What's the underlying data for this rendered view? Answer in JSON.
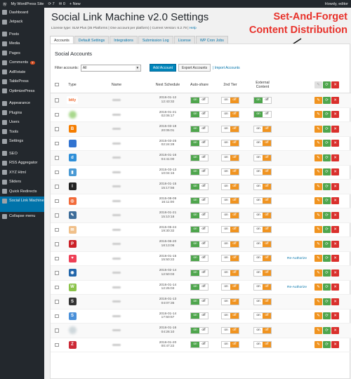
{
  "topbar": {
    "site": "My WordPress Site",
    "updates": "7",
    "comments": "0",
    "new": "+ New",
    "howdy": "Howdy, editor"
  },
  "sidebar": {
    "items": [
      {
        "label": "Dashboard"
      },
      {
        "label": "Jetpack"
      },
      {
        "label": "Posts"
      },
      {
        "label": "Media"
      },
      {
        "label": "Pages"
      },
      {
        "label": "Comments",
        "badge": "7"
      },
      {
        "label": "AdRotate"
      },
      {
        "label": "TablePress"
      },
      {
        "label": "OptimizePress"
      },
      {
        "label": "Appearance"
      },
      {
        "label": "Plugins"
      },
      {
        "label": "Users"
      },
      {
        "label": "Tools"
      },
      {
        "label": "Settings"
      },
      {
        "label": "SEO"
      },
      {
        "label": "RSS Aggregator"
      },
      {
        "label": "XYZ Html"
      },
      {
        "label": "Sliders"
      },
      {
        "label": "Quick Redirects"
      },
      {
        "label": "Social Link Machine"
      },
      {
        "label": "Collapse menu"
      }
    ]
  },
  "page": {
    "title": "Social Link Machine v2.0 Settings",
    "license": "License type: SLM Plus (35 Platforms | One account per platform) | Current Version: 6.2.79 |",
    "help": "Help",
    "annotation_line1": "Set-And-Forget",
    "annotation_line2": "Content Distribution"
  },
  "tabs": [
    {
      "label": "Accounts"
    },
    {
      "label": "Default Settings"
    },
    {
      "label": "Integrations"
    },
    {
      "label": "Submission Log"
    },
    {
      "label": "License"
    },
    {
      "label": "WP Cron Jobs"
    }
  ],
  "panel": {
    "title": "Social Accounts",
    "filter_label": "Filter accounts:",
    "filter_value": "All",
    "add_account": "Add Account",
    "export_accounts": "Export Accounts",
    "import_accounts": "| Import Accounts"
  },
  "table": {
    "headers": {
      "type": "Type",
      "name": "Name",
      "next": "Next Schedule",
      "auto": "Auto-share",
      "tier": "2nd Tier",
      "ext1": "External",
      "ext2": "Content"
    },
    "on": "on",
    "off": "off",
    "reauth": "Re-Authorize",
    "rows": [
      {
        "icon": "bitly",
        "icon_color": "#ee6123",
        "icon_text": "bitly",
        "d": "2016-01-12",
        "t": "12:43:32",
        "auto": "on",
        "tier": "off",
        "ext": "on",
        "reauth": false
      },
      {
        "icon": "blurred-icon",
        "icon_color": "#a8d88c",
        "icon_text": "",
        "d": "2016-01-21",
        "t": "02:06:17",
        "auto": "on",
        "tier": "off",
        "ext": "on",
        "reauth": false
      },
      {
        "icon": "blogger-icon",
        "icon_color": "#f57d00",
        "icon_text": "B",
        "d": "2015-03-18",
        "t": "20:05:01",
        "auto": "on",
        "tier": "off",
        "ext": "off",
        "reauth": false
      },
      {
        "icon": "delicious-icon",
        "icon_color": "#3274d1",
        "icon_text": "",
        "d": "2015-03-25",
        "t": "02:24:28",
        "auto": "on",
        "tier": "off",
        "ext": "off",
        "reauth": false
      },
      {
        "icon": "diigo-icon",
        "icon_color": "#2f8fd8",
        "icon_text": "d",
        "d": "2016-01-16",
        "t": "04:41:00",
        "auto": "on",
        "tier": "off",
        "ext": "off",
        "reauth": false
      },
      {
        "icon": "chart-icon",
        "icon_color": "#4a9ad4",
        "icon_text": "▮",
        "d": "2015-03-13",
        "t": "10:04:16",
        "auto": "on",
        "tier": "off",
        "ext": "off",
        "reauth": false
      },
      {
        "icon": "instapaper-icon",
        "icon_color": "#222222",
        "icon_text": "I",
        "d": "2016-01-15",
        "t": "15:17:56",
        "auto": "on",
        "tier": "off",
        "ext": "off",
        "reauth": false
      },
      {
        "icon": "target-icon",
        "icon_color": "#f26b3a",
        "icon_text": "◎",
        "d": "2015-08-09",
        "t": "16:11:00",
        "auto": "on",
        "tier": "off",
        "ext": "off",
        "reauth": false
      },
      {
        "icon": "linkedin-icon",
        "icon_color": "#3e6d9a",
        "icon_text": "✎",
        "d": "2016-01-21",
        "t": "15:10:18",
        "auto": "on",
        "tier": "off",
        "ext": "off",
        "reauth": false
      },
      {
        "icon": "mail-icon",
        "icon_color": "#f0c08a",
        "icon_text": "✉",
        "d": "2015-05-24",
        "t": "19:30:32",
        "auto": "on",
        "tier": "off",
        "ext": "off",
        "reauth": false
      },
      {
        "icon": "pinterest-icon",
        "icon_color": "#cb2027",
        "icon_text": "P",
        "d": "2015-06-20",
        "t": "18:13:06",
        "auto": "on",
        "tier": "off",
        "ext": "off",
        "reauth": false
      },
      {
        "icon": "pocket-icon",
        "icon_color": "#ee4056",
        "icon_text": "♥",
        "d": "2016-01-15",
        "t": "15:50:22",
        "auto": "on",
        "tier": "off",
        "ext": "off",
        "reauth": true
      },
      {
        "icon": "stumble-icon",
        "icon_color": "#2266aa",
        "icon_text": "◉",
        "d": "2015-02-14",
        "t": "12:50:03",
        "auto": "on",
        "tier": "off",
        "ext": "off",
        "reauth": false
      },
      {
        "icon": "friendfeed-icon",
        "icon_color": "#8bc34a",
        "icon_text": "W",
        "d": "2016-01-14",
        "t": "12:25:03",
        "auto": "on",
        "tier": "off",
        "ext": "off",
        "reauth": true
      },
      {
        "icon": "scoopit-icon",
        "icon_color": "#333333",
        "icon_text": "S",
        "d": "2016-01-13",
        "t": "04:07:35",
        "auto": "on",
        "tier": "off",
        "ext": "off",
        "reauth": false
      },
      {
        "icon": "slm-icon",
        "icon_color": "#4a90d9",
        "icon_text": "S",
        "d": "2016-01-14",
        "t": "17:50:57",
        "auto": "on",
        "tier": "off",
        "ext": "off",
        "reauth": false
      },
      {
        "icon": "blurred-icon",
        "icon_color": "#cfd8dc",
        "icon_text": "",
        "d": "2016-01-16",
        "t": "04:26:10",
        "auto": "on",
        "tier": "off",
        "ext": "off",
        "reauth": false
      },
      {
        "icon": "zotero-icon",
        "icon_color": "#cc2936",
        "icon_text": "Z",
        "d": "2016-01-20",
        "t": "00:47:22",
        "auto": "on",
        "tier": "off",
        "ext": "off",
        "reauth": false
      }
    ]
  }
}
